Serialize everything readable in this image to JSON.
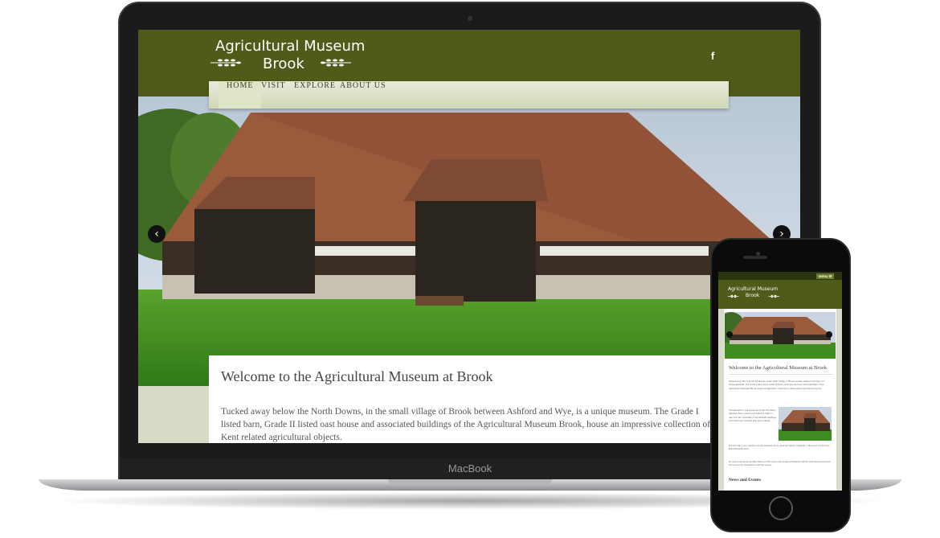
{
  "device_labels": {
    "laptop": "MacBook"
  },
  "site": {
    "logo_line1": "Agricultural Museum",
    "logo_line2": "Brook",
    "social_icon": "f",
    "nav": [
      {
        "label": "HOME",
        "active": true
      },
      {
        "label": "VISIT",
        "active": false
      },
      {
        "label": "EXPLORE",
        "active": false
      },
      {
        "label": "ABOUT US",
        "active": false
      }
    ],
    "slider": {
      "prev": "‹",
      "next": "›"
    },
    "welcome_title": "Welcome to the Agricultural Museum at Brook",
    "intro_text": "Tucked away below the North Downs, in the small village of Brook between Ashford and Wye, is a unique museum. The Grade I listed barn, Grade II listed oast house and associated buildings of the Agricultural Museum Brook, house an impressive collection of Kent related agricultural objects.",
    "colors": {
      "header": "#4e5b19",
      "nav": "#dfe5c9",
      "page_bg": "#d6dcc8"
    }
  },
  "mobile": {
    "menu_label": "MENU ☰",
    "logo_line1": "Agricultural Museum",
    "logo_line2": "Brook",
    "welcome_title": "Welcome to the Agricultural Museum at Brook",
    "para1": "Tucked away below the North Downs, in the small village of Brook between Ashford and Wye, is a unique museum. The Grade I listed barn, Grade II listed oast house and associated buildings of the Agricultural Museum Brook, house an impressive collection of Kent related agricultural objects.",
    "para2": "The museum is owned and run by the Wye Rural Museum Trust, which was formed in 1996, to take over the ownership of the museum buildings and collections from the then Wye College.",
    "para3": "We welcome you to explore our site and learn more about the history, buildings, collections and the Wye Rural Museum Trust.",
    "para4": "As well as the usual opening times we offer tours with our knowledgeable staff for both interested groups and schools by arrangement with the curator.",
    "news_heading": "News and Events"
  }
}
